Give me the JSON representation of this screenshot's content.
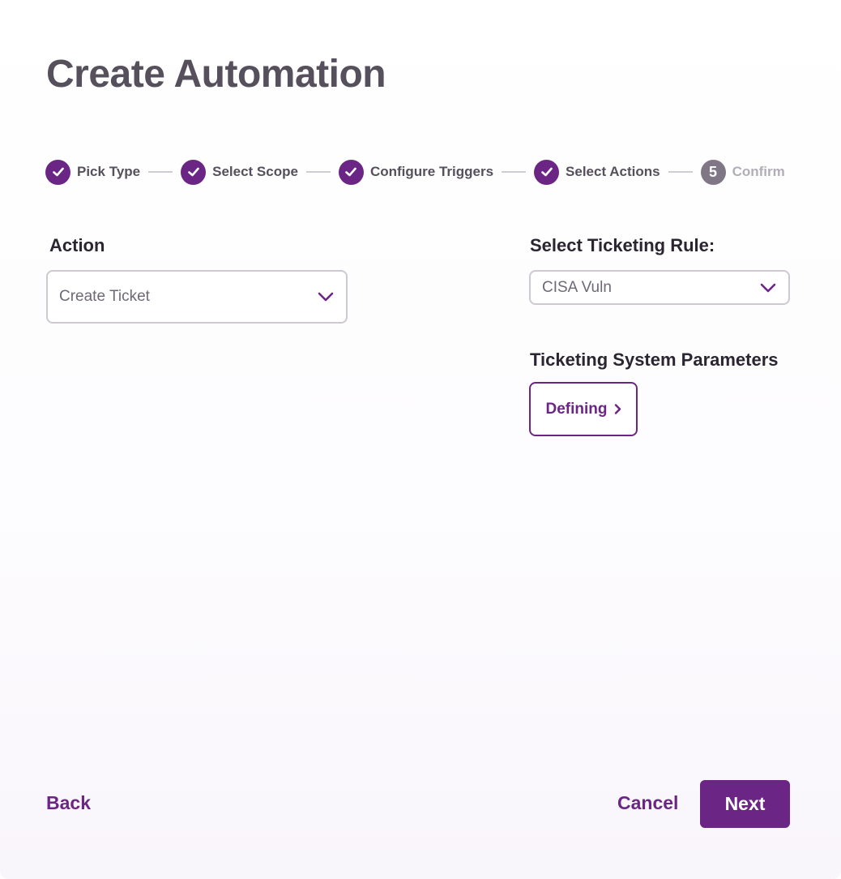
{
  "header": {
    "title": "Create Automation"
  },
  "stepper": {
    "steps": [
      {
        "label": "Pick Type",
        "status": "complete"
      },
      {
        "label": "Select Scope",
        "status": "complete"
      },
      {
        "label": "Configure Triggers",
        "status": "complete"
      },
      {
        "label": "Select Actions",
        "status": "complete"
      },
      {
        "label": "Confirm",
        "status": "pending",
        "number": "5"
      }
    ]
  },
  "action": {
    "label": "Action",
    "selected": "Create Ticket",
    "icon": "chevron-down-icon"
  },
  "ticketing_rule": {
    "label": "Select Ticketing Rule:",
    "selected": "CISA Vuln",
    "icon": "chevron-down-icon"
  },
  "ticketing_params": {
    "label": "Ticketing System Parameters",
    "button_label": "Defining",
    "icon": "chevron-right-icon"
  },
  "footer": {
    "back_label": "Back",
    "cancel_label": "Cancel",
    "next_label": "Next"
  },
  "colors": {
    "accent": "#6b2685",
    "title_text": "#55505c",
    "pending_step": "#7f7786"
  }
}
